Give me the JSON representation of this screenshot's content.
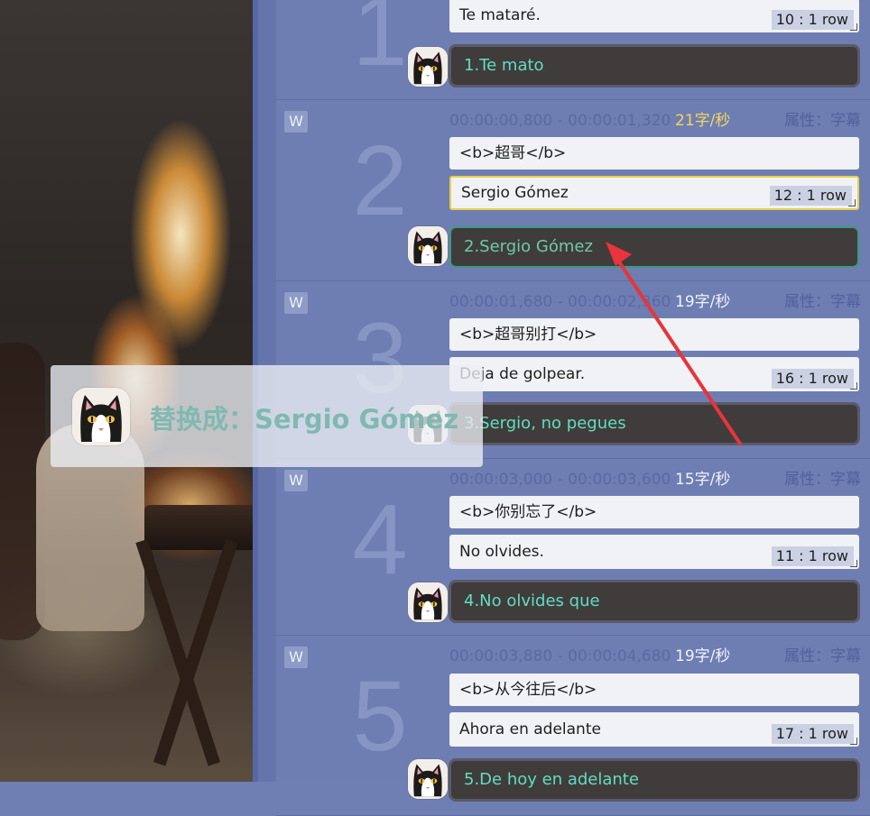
{
  "toast": {
    "message": "替换成：Sergio Gómez"
  },
  "entries": [
    {
      "number": "1",
      "target": "Te mataré.",
      "rows": "10 : 1 row",
      "ai": "1.Te mato"
    },
    {
      "number": "2",
      "w_label": "W",
      "time": "00:00:00,800 - 00:00:01,320",
      "rate": "21字/秒",
      "prop": "属性：字幕",
      "source": "<b>超哥</b>",
      "target": "Sergio Gómez",
      "rows": "12 : 1 row",
      "ai": "2.Sergio Gómez"
    },
    {
      "number": "3",
      "w_label": "W",
      "time": "00:00:01,680 - 00:00:02,360",
      "rate": "19字/秒",
      "prop": "属性：字幕",
      "source": "<b>超哥别打</b>",
      "target": "Deja de golpear.",
      "rows": "16 : 1 row",
      "ai": "3.Sergio, no pegues"
    },
    {
      "number": "4",
      "w_label": "W",
      "time": "00:00:03,000 - 00:00:03,600",
      "rate": "15字/秒",
      "prop": "属性：字幕",
      "source": "<b>你别忘了</b>",
      "target": "No olvides.",
      "rows": "11 : 1 row",
      "ai": "4.No olvides que"
    },
    {
      "number": "5",
      "w_label": "W",
      "time": "00:00:03,880 - 00:00:04,680",
      "rate": "19字/秒",
      "prop": "属性：字幕",
      "source": "<b>从今往后</b>",
      "target": "Ahora en adelante",
      "rows": "17 : 1 row",
      "ai": "5.De hoy en adelante"
    }
  ],
  "colors": {
    "rate_highlight": "#f5d65a",
    "active_border": "#e8cf46",
    "ai_text": "#62dcc0",
    "arrow": "#e8343a"
  }
}
